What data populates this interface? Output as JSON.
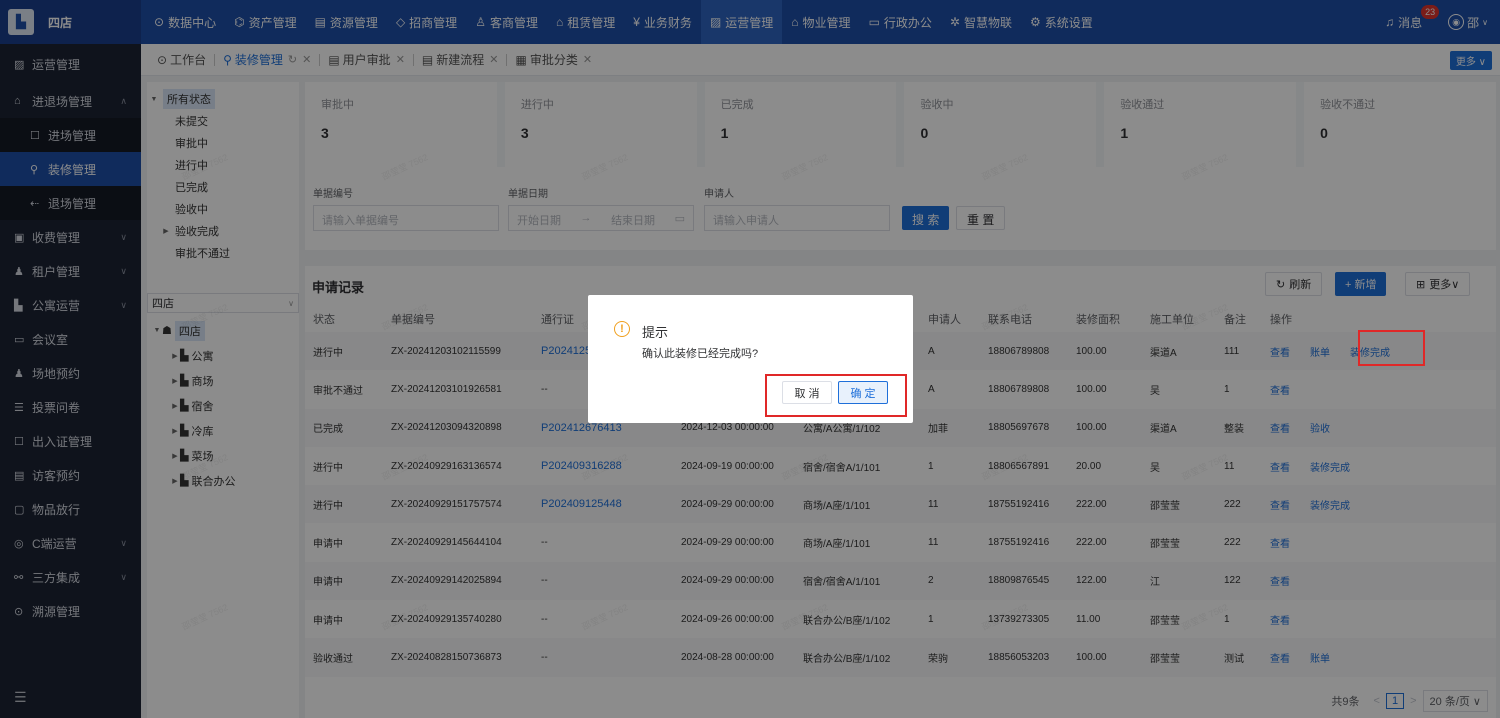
{
  "app": {
    "logo_text": "四店"
  },
  "topnav": [
    {
      "icon": "⊙",
      "label": "数据中心"
    },
    {
      "icon": "⌬",
      "label": "资产管理"
    },
    {
      "icon": "▤",
      "label": "资源管理"
    },
    {
      "icon": "◇",
      "label": "招商管理"
    },
    {
      "icon": "♙",
      "label": "客商管理"
    },
    {
      "icon": "⌂",
      "label": "租赁管理"
    },
    {
      "icon": "¥",
      "label": "业务财务"
    },
    {
      "icon": "▨",
      "label": "运营管理"
    },
    {
      "icon": "⌂",
      "label": "物业管理"
    },
    {
      "icon": "▭",
      "label": "行政办公"
    },
    {
      "icon": "✲",
      "label": "智慧物联"
    },
    {
      "icon": "⚙",
      "label": "系统设置"
    }
  ],
  "header": {
    "messages_label": "消息",
    "messages_count": "23",
    "user_label": "邵"
  },
  "sidebar": {
    "title": "运营管理",
    "items": [
      {
        "icon": "⌂",
        "label": "进退场管理"
      },
      {
        "icon": "☐",
        "label": "进场管理"
      },
      {
        "icon": "⚲",
        "label": "装修管理"
      },
      {
        "icon": "⇠",
        "label": "退场管理"
      },
      {
        "icon": "▣",
        "label": "收费管理"
      },
      {
        "icon": "♟",
        "label": "租户管理"
      },
      {
        "icon": "▙",
        "label": "公寓运营"
      },
      {
        "icon": "▭",
        "label": "会议室"
      },
      {
        "icon": "♟",
        "label": "场地预约"
      },
      {
        "icon": "☰",
        "label": "投票问卷"
      },
      {
        "icon": "☐",
        "label": "出入证管理"
      },
      {
        "icon": "▤",
        "label": "访客预约"
      },
      {
        "icon": "▢",
        "label": "物品放行"
      },
      {
        "icon": "◎",
        "label": "C端运营"
      },
      {
        "icon": "⚯",
        "label": "三方集成"
      },
      {
        "icon": "⊙",
        "label": "溯源管理"
      }
    ]
  },
  "tabs": [
    {
      "icon": "⊙",
      "label": "工作台"
    },
    {
      "icon": "⚲",
      "label": "装修管理"
    },
    {
      "icon": "▤",
      "label": "用户审批"
    },
    {
      "icon": "▤",
      "label": "新建流程"
    },
    {
      "icon": "▦",
      "label": "审批分类"
    }
  ],
  "tab_more": "更多 ∨",
  "status_tree": [
    "所有状态",
    "未提交",
    "审批中",
    "进行中",
    "已完成",
    "验收中",
    "验收完成",
    "审批不通过"
  ],
  "store_select": "四店",
  "location_tree": [
    "四店",
    "公寓",
    "商场",
    "宿舍",
    "冷库",
    "菜场",
    "联合办公"
  ],
  "stats": [
    {
      "label": "审批中",
      "value": "3"
    },
    {
      "label": "进行中",
      "value": "3"
    },
    {
      "label": "已完成",
      "value": "1"
    },
    {
      "label": "验收中",
      "value": "0"
    },
    {
      "label": "验收通过",
      "value": "1"
    },
    {
      "label": "验收不通过",
      "value": "0"
    }
  ],
  "filters": {
    "order_no_label": "单据编号",
    "order_no_placeholder": "请输入单据编号",
    "date_label": "单据日期",
    "date_start": "开始日期",
    "date_arrow": "→",
    "date_end": "结束日期",
    "applicant_label": "申请人",
    "applicant_placeholder": "请输入申请人",
    "search": "搜 索",
    "reset": "重 置"
  },
  "records": {
    "title": "申请记录",
    "refresh": "刷新",
    "add": "+ 新增",
    "more": "更多∨",
    "columns": [
      "状态",
      "单据编号",
      "通行证",
      "",
      "",
      "申请人",
      "联系电话",
      "装修面积",
      "施工单位",
      "备注",
      "操作"
    ],
    "rows": [
      {
        "status": "进行中",
        "no": "ZX-20241203102115599",
        "pass": "P2024125",
        "date": "",
        "loc": "",
        "applicant": "A",
        "phone": "18806789808",
        "area": "100.00",
        "unit": "渠道A",
        "note": "111",
        "ops": [
          "查看",
          "账单",
          "装修完成"
        ]
      },
      {
        "status": "审批不通过",
        "no": "ZX-20241203101926581",
        "pass": "--",
        "date": "",
        "loc": "",
        "applicant": "A",
        "phone": "18806789808",
        "area": "100.00",
        "unit": "吴",
        "note": "1",
        "ops": [
          "查看"
        ]
      },
      {
        "status": "已完成",
        "no": "ZX-20241203094320898",
        "pass": "P202412676413",
        "date": "2024-12-03 00:00:00",
        "loc": "公寓/A公寓/1/102",
        "applicant": "加菲",
        "phone": "18805697678",
        "area": "100.00",
        "unit": "渠道A",
        "note": "整装",
        "ops": [
          "查看",
          "验收"
        ]
      },
      {
        "status": "进行中",
        "no": "ZX-20240929163136574",
        "pass": "P202409316288",
        "date": "2024-09-19 00:00:00",
        "loc": "宿舍/宿舍A/1/101",
        "applicant": "1",
        "phone": "18806567891",
        "area": "20.00",
        "unit": "吴",
        "note": "11",
        "ops": [
          "查看",
          "装修完成"
        ]
      },
      {
        "status": "进行中",
        "no": "ZX-20240929151757574",
        "pass": "P202409125448",
        "date": "2024-09-29 00:00:00",
        "loc": "商场/A座/1/101",
        "applicant": "11",
        "phone": "18755192416",
        "area": "222.00",
        "unit": "邵莹莹",
        "note": "222",
        "ops": [
          "查看",
          "装修完成"
        ]
      },
      {
        "status": "申请中",
        "no": "ZX-20240929145644104",
        "pass": "--",
        "date": "2024-09-29 00:00:00",
        "loc": "商场/A座/1/101",
        "applicant": "11",
        "phone": "18755192416",
        "area": "222.00",
        "unit": "邵莹莹",
        "note": "222",
        "ops": [
          "查看"
        ]
      },
      {
        "status": "申请中",
        "no": "ZX-20240929142025894",
        "pass": "--",
        "date": "2024-09-29 00:00:00",
        "loc": "宿舍/宿舍A/1/101",
        "applicant": "2",
        "phone": "18809876545",
        "area": "122.00",
        "unit": "江",
        "note": "122",
        "ops": [
          "查看"
        ]
      },
      {
        "status": "申请中",
        "no": "ZX-20240929135740280",
        "pass": "--",
        "date": "2024-09-26 00:00:00",
        "loc": "联合办公/B座/1/102",
        "applicant": "1",
        "phone": "13739273305",
        "area": "11.00",
        "unit": "邵莹莹",
        "note": "1",
        "ops": [
          "查看"
        ]
      },
      {
        "status": "验收通过",
        "no": "ZX-20240828150736873",
        "pass": "--",
        "date": "2024-08-28 00:00:00",
        "loc": "联合办公/B座/1/102",
        "applicant": "荣驹",
        "phone": "18856053203",
        "area": "100.00",
        "unit": "邵莹莹",
        "note": "测试",
        "ops": [
          "查看",
          "账单"
        ]
      }
    ]
  },
  "pagination": {
    "total": "共9条",
    "prev": "<",
    "page": "1",
    "next": ">",
    "size": "20 条/页 ∨"
  },
  "dialog": {
    "icon": "!",
    "title": "提示",
    "message": "确认此装修已经完成吗?",
    "cancel": "取 消",
    "confirm": "确 定"
  },
  "watermark": "邵莹莹 7562"
}
